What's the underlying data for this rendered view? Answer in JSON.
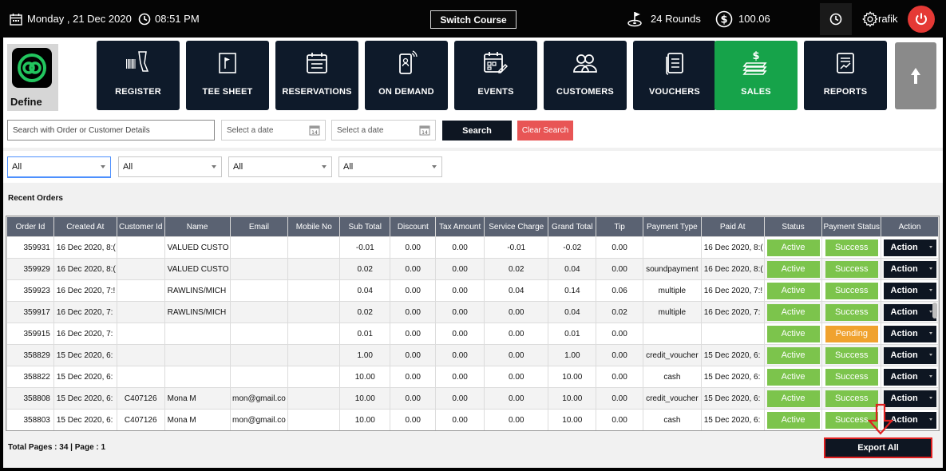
{
  "topbar": {
    "date": "Monday , 21 Dec 2020",
    "time": "08:51 PM",
    "switch_course": "Switch Course",
    "rounds": "24 Rounds",
    "balance": "100.06",
    "user": "rafik"
  },
  "logo": {
    "label": "Define"
  },
  "nav": [
    {
      "label": "REGISTER",
      "icon": "barcode-scanner-icon"
    },
    {
      "label": "TEE SHEET",
      "icon": "flag-icon"
    },
    {
      "label": "RESERVATIONS",
      "icon": "calendar-list-icon"
    },
    {
      "label": "ON DEMAND",
      "icon": "mobile-icon"
    },
    {
      "label": "EVENTS",
      "icon": "calendar-edit-icon"
    },
    {
      "label": "CUSTOMERS",
      "icon": "users-icon"
    },
    {
      "label": "VOUCHERS",
      "icon": "voucher-icon"
    },
    {
      "label": "SALES",
      "icon": "money-icon",
      "active": true
    },
    {
      "label": "REPORTS",
      "icon": "report-icon"
    }
  ],
  "search": {
    "placeholder": "Search with Order or Customer Details",
    "date1_placeholder": "Select a date",
    "date2_placeholder": "Select a date",
    "search_label": "Search",
    "clear_label": "Clear Search"
  },
  "filters": [
    "All",
    "All",
    "All",
    "All"
  ],
  "recent_orders_title": "Recent Orders",
  "table": {
    "headers": [
      "Order Id",
      "Created At",
      "Customer Id",
      "Name",
      "Email",
      "Mobile No",
      "Sub Total",
      "Discount",
      "Tax Amount",
      "Service Charge",
      "Grand Total",
      "Tip",
      "Payment Type",
      "Paid At",
      "Status",
      "Payment Status",
      "Action"
    ],
    "rows": [
      [
        "359931",
        "16 Dec 2020, 8:(",
        "",
        "VALUED CUSTO",
        "",
        "",
        "-0.01",
        "0.00",
        "0.00",
        "-0.01",
        "-0.02",
        "0.00",
        "",
        "16 Dec 2020, 8:(",
        "Active",
        "Success",
        "Action"
      ],
      [
        "359929",
        "16 Dec 2020, 8:(",
        "",
        "VALUED CUSTO",
        "",
        "",
        "0.02",
        "0.00",
        "0.00",
        "0.02",
        "0.04",
        "0.00",
        "soundpayment",
        "16 Dec 2020, 8:(",
        "Active",
        "Success",
        "Action"
      ],
      [
        "359923",
        "16 Dec 2020, 7:!",
        "",
        "RAWLINS/MICH",
        "",
        "",
        "0.04",
        "0.00",
        "0.00",
        "0.04",
        "0.14",
        "0.06",
        "multiple",
        "16 Dec 2020, 7:!",
        "Active",
        "Success",
        "Action"
      ],
      [
        "359917",
        "16 Dec 2020, 7:",
        "",
        "RAWLINS/MICH",
        "",
        "",
        "0.02",
        "0.00",
        "0.00",
        "0.00",
        "0.04",
        "0.02",
        "multiple",
        "16 Dec 2020, 7:",
        "Active",
        "Success",
        "Action"
      ],
      [
        "359915",
        "16 Dec 2020, 7:",
        "",
        "",
        "",
        "",
        "0.01",
        "0.00",
        "0.00",
        "0.00",
        "0.01",
        "0.00",
        "",
        "",
        "Active",
        "Pending",
        "Action"
      ],
      [
        "358829",
        "15 Dec 2020, 6:",
        "",
        "",
        "",
        "",
        "1.00",
        "0.00",
        "0.00",
        "0.00",
        "1.00",
        "0.00",
        "credit_voucher",
        "15 Dec 2020, 6:",
        "Active",
        "Success",
        "Action"
      ],
      [
        "358822",
        "15 Dec 2020, 6:",
        "",
        "",
        "",
        "",
        "10.00",
        "0.00",
        "0.00",
        "0.00",
        "10.00",
        "0.00",
        "cash",
        "15 Dec 2020, 6:",
        "Active",
        "Success",
        "Action"
      ],
      [
        "358808",
        "15 Dec 2020, 6:",
        "C407126",
        "Mona M",
        "mon@gmail.co",
        "",
        "10.00",
        "0.00",
        "0.00",
        "0.00",
        "10.00",
        "0.00",
        "credit_voucher",
        "15 Dec 2020, 6:",
        "Active",
        "Success",
        "Action"
      ],
      [
        "358803",
        "15 Dec 2020, 6:",
        "C407126",
        "Mona M",
        "mon@gmail.co",
        "",
        "10.00",
        "0.00",
        "0.00",
        "0.00",
        "10.00",
        "0.00",
        "cash",
        "15 Dec 2020, 6:",
        "Active",
        "Success",
        "Action"
      ]
    ]
  },
  "footer": {
    "pages": "Total Pages : 34 | Page : 1",
    "export_label": "Export All"
  },
  "colors": {
    "nav_tile": "#0e1a2a",
    "active_tile": "#16a34a",
    "header_bg": "#5a6272",
    "success": "#7cc44c",
    "pending": "#f0a22e",
    "danger": "#e53935"
  }
}
